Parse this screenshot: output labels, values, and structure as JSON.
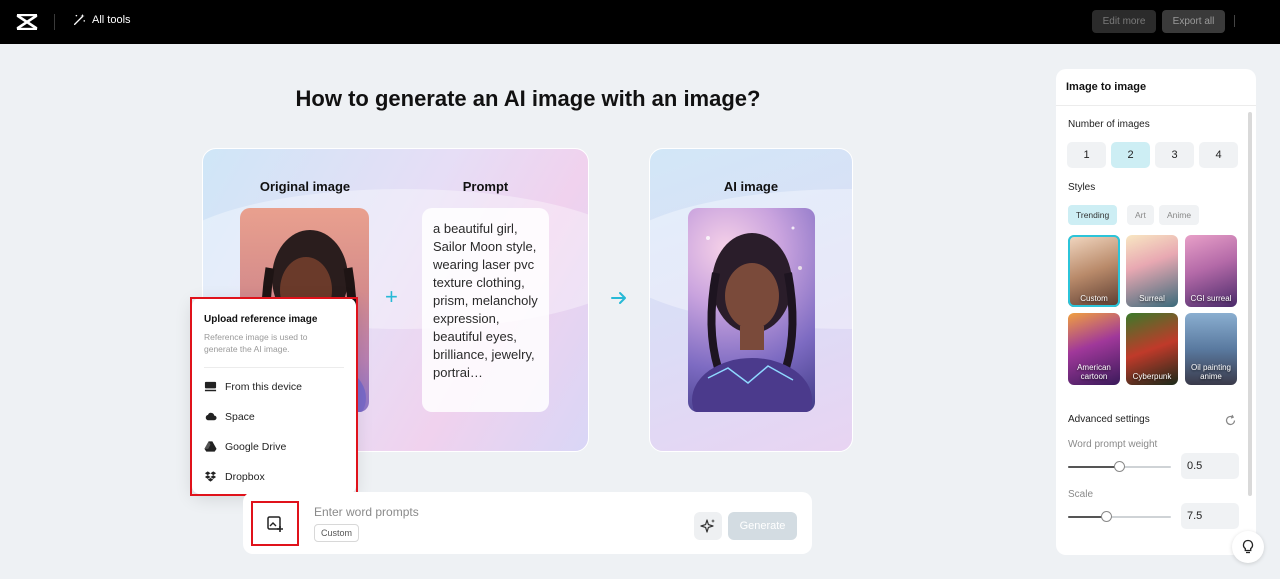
{
  "topbar": {
    "all_tools": "All tools",
    "edit_more": "Edit more",
    "export_all": "Export all"
  },
  "headline": "How to generate an AI image with an image?",
  "demo": {
    "original_label": "Original image",
    "prompt_label": "Prompt",
    "ai_label": "AI image",
    "prompt_text": "a beautiful girl, Sailor Moon style, wearing laser pvc texture clothing, prism, melancholy expression, beautiful eyes, brilliance, jewelry, portrai…",
    "plus_symbol": "+",
    "arrow_icon": "arrow-right-icon"
  },
  "upload_popup": {
    "title": "Upload reference image",
    "description": "Reference image is used to generate the AI image.",
    "items": [
      {
        "label": "From this device",
        "icon": "monitor-icon"
      },
      {
        "label": "Space",
        "icon": "cloud-icon"
      },
      {
        "label": "Google Drive",
        "icon": "google-drive-icon"
      },
      {
        "label": "Dropbox",
        "icon": "dropbox-icon"
      }
    ]
  },
  "prompt_bar": {
    "placeholder": "Enter word prompts",
    "style_tag": "Custom",
    "generate": "Generate"
  },
  "panel": {
    "title": "Image to image",
    "number_label": "Number of images",
    "numbers": [
      "1",
      "2",
      "3",
      "4"
    ],
    "selected_number": "2",
    "styles_label": "Styles",
    "style_tabs": [
      "Trending",
      "Art",
      "Anime"
    ],
    "active_style_tab": "Trending",
    "styles": [
      {
        "name": "Custom",
        "selected": true
      },
      {
        "name": "Surreal",
        "selected": false
      },
      {
        "name": "CGI surreal",
        "selected": false
      },
      {
        "name": "American cartoon",
        "selected": false
      },
      {
        "name": "Cyberpunk",
        "selected": false
      },
      {
        "name": "Oil painting anime",
        "selected": false
      }
    ],
    "advanced_label": "Advanced settings",
    "word_weight_label": "Word prompt weight",
    "word_weight_value": "0.5",
    "scale_label": "Scale",
    "scale_value": "7.5"
  },
  "colors": {
    "accent": "#27b9d6",
    "highlight_red": "#e0121b",
    "active_chip": "#cdeef4"
  }
}
